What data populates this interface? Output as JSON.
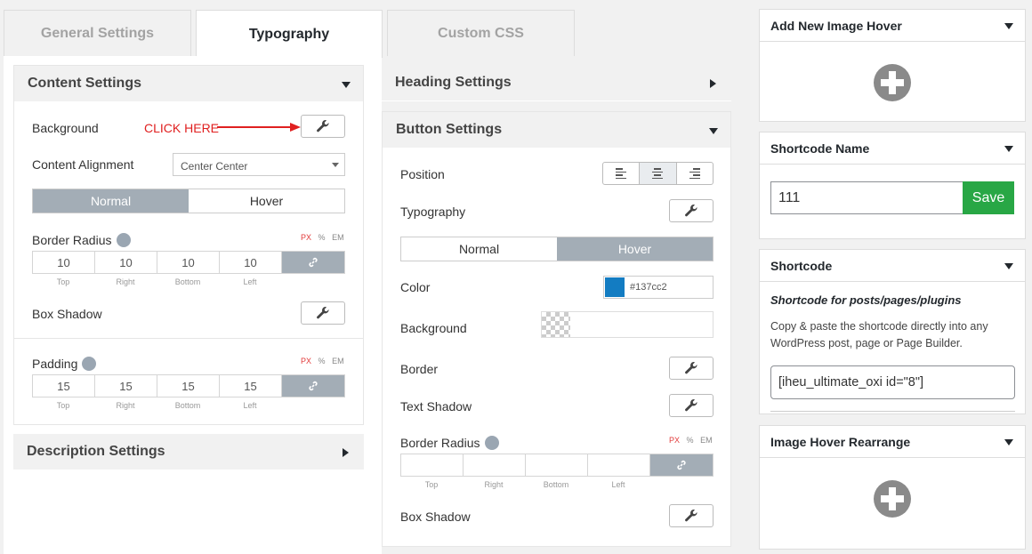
{
  "tabs": [
    {
      "label": "General Settings",
      "active": false
    },
    {
      "label": "Typography",
      "active": true
    },
    {
      "label": "Custom CSS",
      "active": false
    }
  ],
  "content_settings": {
    "title": "Content Settings",
    "background_label": "Background",
    "annotation": "CLICK HERE",
    "alignment_label": "Content Alignment",
    "alignment_value": "Center Center",
    "mode_normal": "Normal",
    "mode_hover": "Hover",
    "border_radius_label": "Border Radius",
    "units": [
      "PX",
      "%",
      "EM"
    ],
    "border_radius_values": [
      "10",
      "10",
      "10",
      "10"
    ],
    "side_labels": [
      "Top",
      "Right",
      "Bottom",
      "Left"
    ],
    "box_shadow_label": "Box Shadow",
    "padding_label": "Padding",
    "padding_values": [
      "15",
      "15",
      "15",
      "15"
    ]
  },
  "description_settings": {
    "title": "Description Settings"
  },
  "heading_settings": {
    "title": "Heading Settings"
  },
  "button_settings": {
    "title": "Button Settings",
    "position_label": "Position",
    "typography_label": "Typography",
    "mode_normal": "Normal",
    "mode_hover": "Hover",
    "color_label": "Color",
    "color_value": "#137cc2",
    "color_swatch": "#137cc2",
    "background_label": "Background",
    "border_label": "Border",
    "text_shadow_label": "Text Shadow",
    "border_radius_label": "Border Radius",
    "box_shadow_label": "Box Shadow"
  },
  "sidebar": {
    "add_new_title": "Add New Image Hover",
    "shortcode_name_title": "Shortcode Name",
    "shortcode_name_value": "111",
    "save_label": "Save",
    "shortcode_title": "Shortcode",
    "shortcode_subtitle": "Shortcode for posts/pages/plugins",
    "shortcode_desc": "Copy & paste the shortcode directly into any WordPress post, page or Page Builder.",
    "shortcode_value": "[iheu_ultimate_oxi id=\"8\"]",
    "rearrange_title": "Image Hover Rearrange"
  },
  "colors": {
    "accent": "#a3adb6",
    "save": "#28a745",
    "annotation": "#e02020"
  }
}
